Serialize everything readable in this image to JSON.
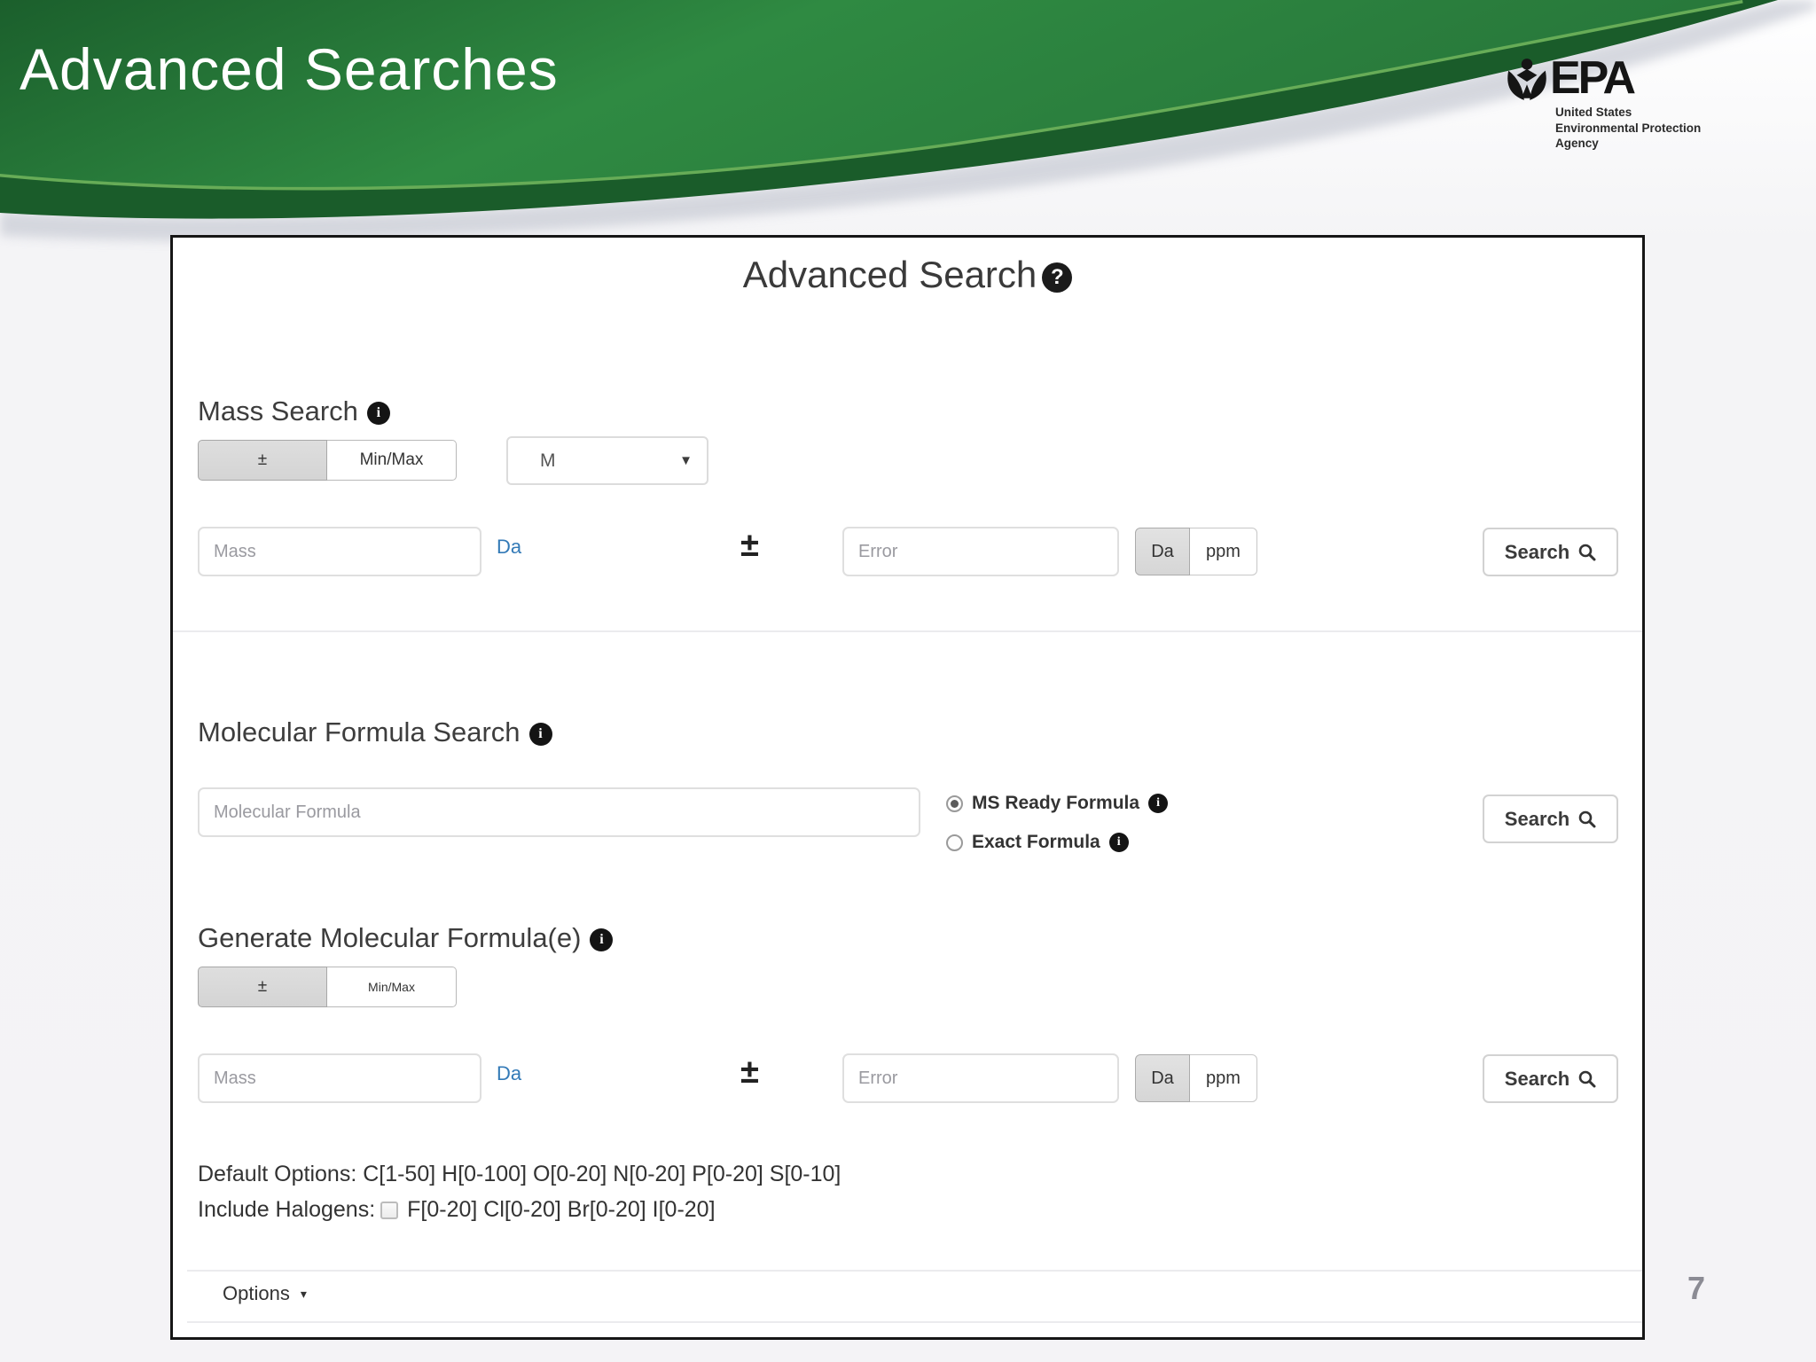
{
  "slide": {
    "title": "Advanced Searches",
    "page_number": "7"
  },
  "epa_logo": {
    "acronym": "EPA",
    "line1": "United States",
    "line2": "Environmental Protection",
    "line3": "Agency"
  },
  "panel": {
    "title": "Advanced Search",
    "help_icon_glyph": "?",
    "info_icon_glyph": "i",
    "mass_search": {
      "heading": "Mass Search",
      "toggle_pm": "±",
      "toggle_minmax": "Min/Max",
      "type_dropdown_value": "M",
      "dropdown_caret": "▼",
      "mass_placeholder": "Mass",
      "da_label": "Da",
      "pm_symbol": "±",
      "error_placeholder": "Error",
      "unit_da": "Da",
      "unit_ppm": "ppm",
      "search_label": "Search"
    },
    "formula_search": {
      "heading": "Molecular Formula Search",
      "input_placeholder": "Molecular Formula",
      "radio_ms_ready": "MS Ready Formula",
      "radio_exact": "Exact Formula",
      "search_label": "Search"
    },
    "generate_formula": {
      "heading": "Generate Molecular Formula(e)",
      "toggle_pm": "±",
      "toggle_minmax": "Min/Max",
      "mass_placeholder": "Mass",
      "da_label": "Da",
      "pm_symbol": "±",
      "error_placeholder": "Error",
      "unit_da": "Da",
      "unit_ppm": "ppm",
      "search_label": "Search",
      "default_options": "Default Options: C[1-50] H[0-100] O[0-20] N[0-20] P[0-20] S[0-10]",
      "include_halogens_label": "Include Halogens:",
      "halogens": "F[0-20] Cl[0-20] Br[0-20] I[0-20]",
      "options_label": "Options",
      "options_caret": "▾"
    }
  },
  "colors": {
    "green_dark": "#1b5e2b",
    "green_main": "#2e8742",
    "green_highlight": "#67ac57",
    "accent_blue": "#337ab7"
  }
}
